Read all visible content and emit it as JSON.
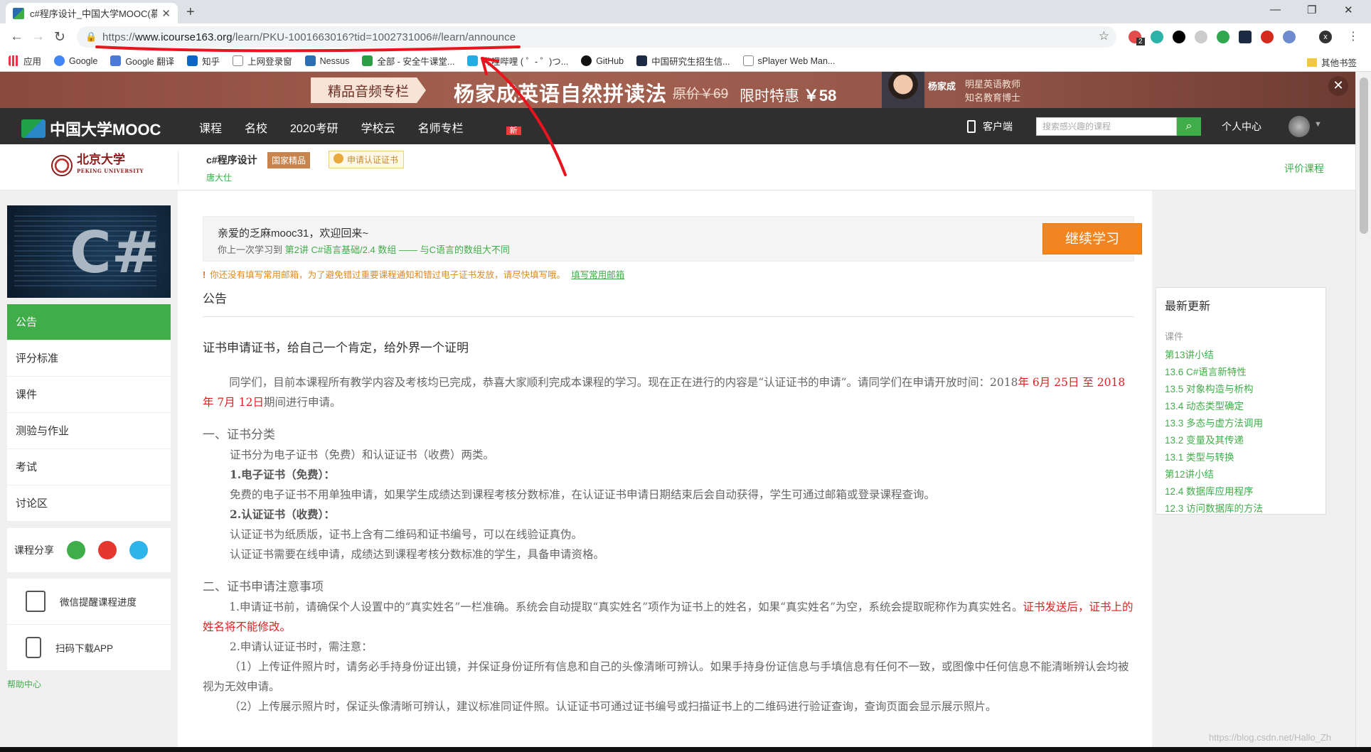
{
  "browser": {
    "tab_title": "c#程序设计_中国大学MOOC(慕",
    "url_prefix": "https://",
    "url_host": "www.icourse163.org",
    "url_path": "/learn/PKU-1001663016?tid=1002731006#/learn/announce",
    "bookmarks": [
      "应用",
      "Google",
      "Google 翻译",
      "知乎",
      "上网登录窗",
      "Nessus",
      "全部 - 安全牛课堂...",
      "哔哩哔哩 ( ゜- ゜)つ...",
      "GitHub",
      "中国研究生招生信...",
      "sPlayer Web Man..."
    ],
    "other_bookmarks": "其他书签",
    "ext_badge": "2",
    "profile_initial": "x"
  },
  "banner": {
    "tag": "精品音频专栏",
    "title": "杨家成英语自然拼读法",
    "orig_price": "原价￥69",
    "deal_label": "限时特惠",
    "deal_price": "￥58",
    "teacher_name": "杨家成",
    "teacher_desc1": "明星英语教师",
    "teacher_desc2": "知名教育博士",
    "close": "✕"
  },
  "nav": {
    "logo": "中国大学MOOC",
    "links": [
      "课程",
      "名校",
      "2020考研",
      "学校云",
      "名师专栏"
    ],
    "new_badge": "新",
    "client": "客户端",
    "search_placeholder": "搜索感兴趣的课程",
    "personal": "个人中心"
  },
  "course": {
    "school": "北京大学",
    "school_en": "PEKING UNIVERSITY",
    "name": "c#程序设计",
    "tag_national": "国家精品",
    "tag_cert": "申请认证证书",
    "teacher": "唐大仕",
    "evaluate": "评价课程"
  },
  "sidebar": {
    "cover_text": "C#",
    "menu": [
      "公告",
      "评分标准",
      "课件",
      "测验与作业",
      "考试",
      "讨论区"
    ],
    "share_label": "课程分享",
    "tools": [
      "微信提醒课程进度",
      "扫码下载APP"
    ],
    "help": "帮助中心"
  },
  "main": {
    "welcome": "亲爱的乏麻mooc31，欢迎回来~",
    "last_prefix": "你上一次学习到",
    "last_lesson": "第2讲 C#语言基础/2.4 数组 —— 与C语言的数组大不同",
    "continue": "继续学习",
    "warning": "你还没有填写常用邮箱，为了避免错过重要课程通知和错过电子证书发放，请尽快填写哦。",
    "warning_link": "填写常用邮箱",
    "section": "公告",
    "ann_title": "证书申请证书，给自己一个肯定，给外界一个证明",
    "p1a": "同学们，目前本课程所有教学内容及考核均已完成，恭喜大家顺利完成本课程的学习。现在正在进行的内容是“认证证书的申请”。请同学们在申请开放时间：2018",
    "p1b": "年 6月 25日 至 2018年 7月 12日",
    "p1c": "期间进行申请。",
    "s1": "一、证书分类",
    "s1a": "证书分为电子证书（免费）和认证证书（收费）两类。",
    "s1b": "1.电子证书（免费）：",
    "s1c": "免费的电子证书不用单独申请，如果学生成绩达到课程考核分数标准，在认证证书申请日期结束后会自动获得，学生可通过邮箱或登录课程查询。",
    "s1d": "2.认证证书（收费）：",
    "s1e": "认证证书为纸质版，证书上含有二维码和证书编号，可以在线验证真伪。",
    "s1f": "认证证书需要在线申请，成绩达到课程考核分数标准的学生，具备申请资格。",
    "s2": "二、证书申请注意事项",
    "s2a": "1.申请证书前，请确保个人设置中的“真实姓名”一栏准确。系统会自动提取“真实姓名”项作为证书上的姓名，如果“真实姓名”为空，系统会提取昵称作为真实姓名。",
    "s2a_red": "证书发送后，证书上的姓名将不能修改。",
    "s2b": "2.申请认证证书时，需注意：",
    "s2c": "（1）上传证件照片时，请务必手持身份证出镜，并保证身份证所有信息和自己的头像清晰可辨认。如果手持身份证信息与手填信息有任何不一致，或图像中任何信息不能清晰辨认会均被视为无效申请。",
    "s2d": "（2）上传展示照片时，保证头像清晰可辨认，建议标准同证件照。认证证书可通过证书编号或扫描证书上的二维码进行验证查询，查询页面会显示展示照片。"
  },
  "updates": {
    "title": "最新更新",
    "category": "课件",
    "items": [
      "第13讲小结",
      "13.6 C#语言新特性",
      "13.5 对象构造与析构",
      "13.4 动态类型确定",
      "13.3 多态与虚方法调用",
      "13.2 变量及其传递",
      "13.1 类型与转换",
      "第12讲小结",
      "12.4 数据库应用程序",
      "12.3 访问数据库的方法"
    ]
  },
  "watermark": "https://blog.csdn.net/Hallo_Zh",
  "colors": {
    "accent": "#3fae49",
    "orange": "#f2851f",
    "nav": "#2f2f2f",
    "annotation": "#e8141e"
  }
}
